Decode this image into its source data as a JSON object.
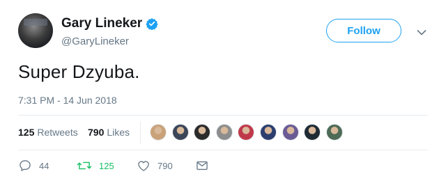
{
  "user": {
    "display_name": "Gary Lineker",
    "handle": "@GaryLineker",
    "verified": true
  },
  "follow_label": "Follow",
  "tweet": {
    "text": "Super Dzyuba.",
    "timestamp": "7:31 PM - 14 Jun 2018"
  },
  "stats": {
    "retweets_count": "125",
    "retweets_label": "Retweets",
    "likes_count": "790",
    "likes_label": "Likes"
  },
  "likers": [
    {
      "color": "#c9a27a"
    },
    {
      "color": "#3b4658"
    },
    {
      "color": "#2b2b2b"
    },
    {
      "color": "#8d8d8d"
    },
    {
      "color": "#c0394a"
    },
    {
      "color": "#2c3e6e"
    },
    {
      "color": "#6b5b95"
    },
    {
      "color": "#1f2b33"
    },
    {
      "color": "#4d6b57"
    }
  ],
  "actions": {
    "reply_count": "44",
    "retweet_count": "125",
    "like_count": "790"
  },
  "colors": {
    "accent": "#1da1f2",
    "retweet_green": "#17bf63",
    "muted": "#657786",
    "text": "#14171a"
  }
}
